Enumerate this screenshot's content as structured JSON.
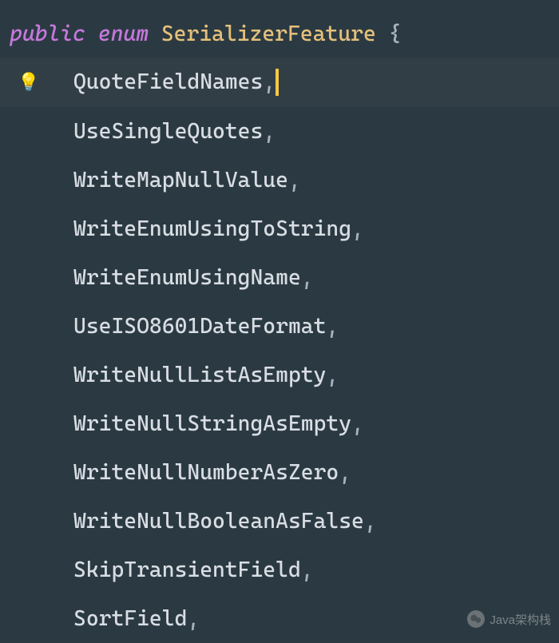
{
  "code": {
    "declaration": {
      "public_kw": "public",
      "enum_kw": "enum",
      "class_name": "SerializerFeature",
      "open_brace": "{"
    },
    "enum_values": [
      {
        "name": "QuoteFieldNames",
        "highlighted": true,
        "has_bulb": true,
        "has_cursor": true
      },
      {
        "name": "UseSingleQuotes"
      },
      {
        "name": "WriteMapNullValue"
      },
      {
        "name": "WriteEnumUsingToString"
      },
      {
        "name": "WriteEnumUsingName"
      },
      {
        "name": "UseISO8601DateFormat"
      },
      {
        "name": "WriteNullListAsEmpty"
      },
      {
        "name": "WriteNullStringAsEmpty"
      },
      {
        "name": "WriteNullNumberAsZero"
      },
      {
        "name": "WriteNullBooleanAsFalse"
      },
      {
        "name": "SkipTransientField"
      },
      {
        "name": "SortField"
      }
    ],
    "comma": ","
  },
  "icons": {
    "bulb": "💡"
  },
  "watermark": {
    "text": "Java架构栈"
  }
}
